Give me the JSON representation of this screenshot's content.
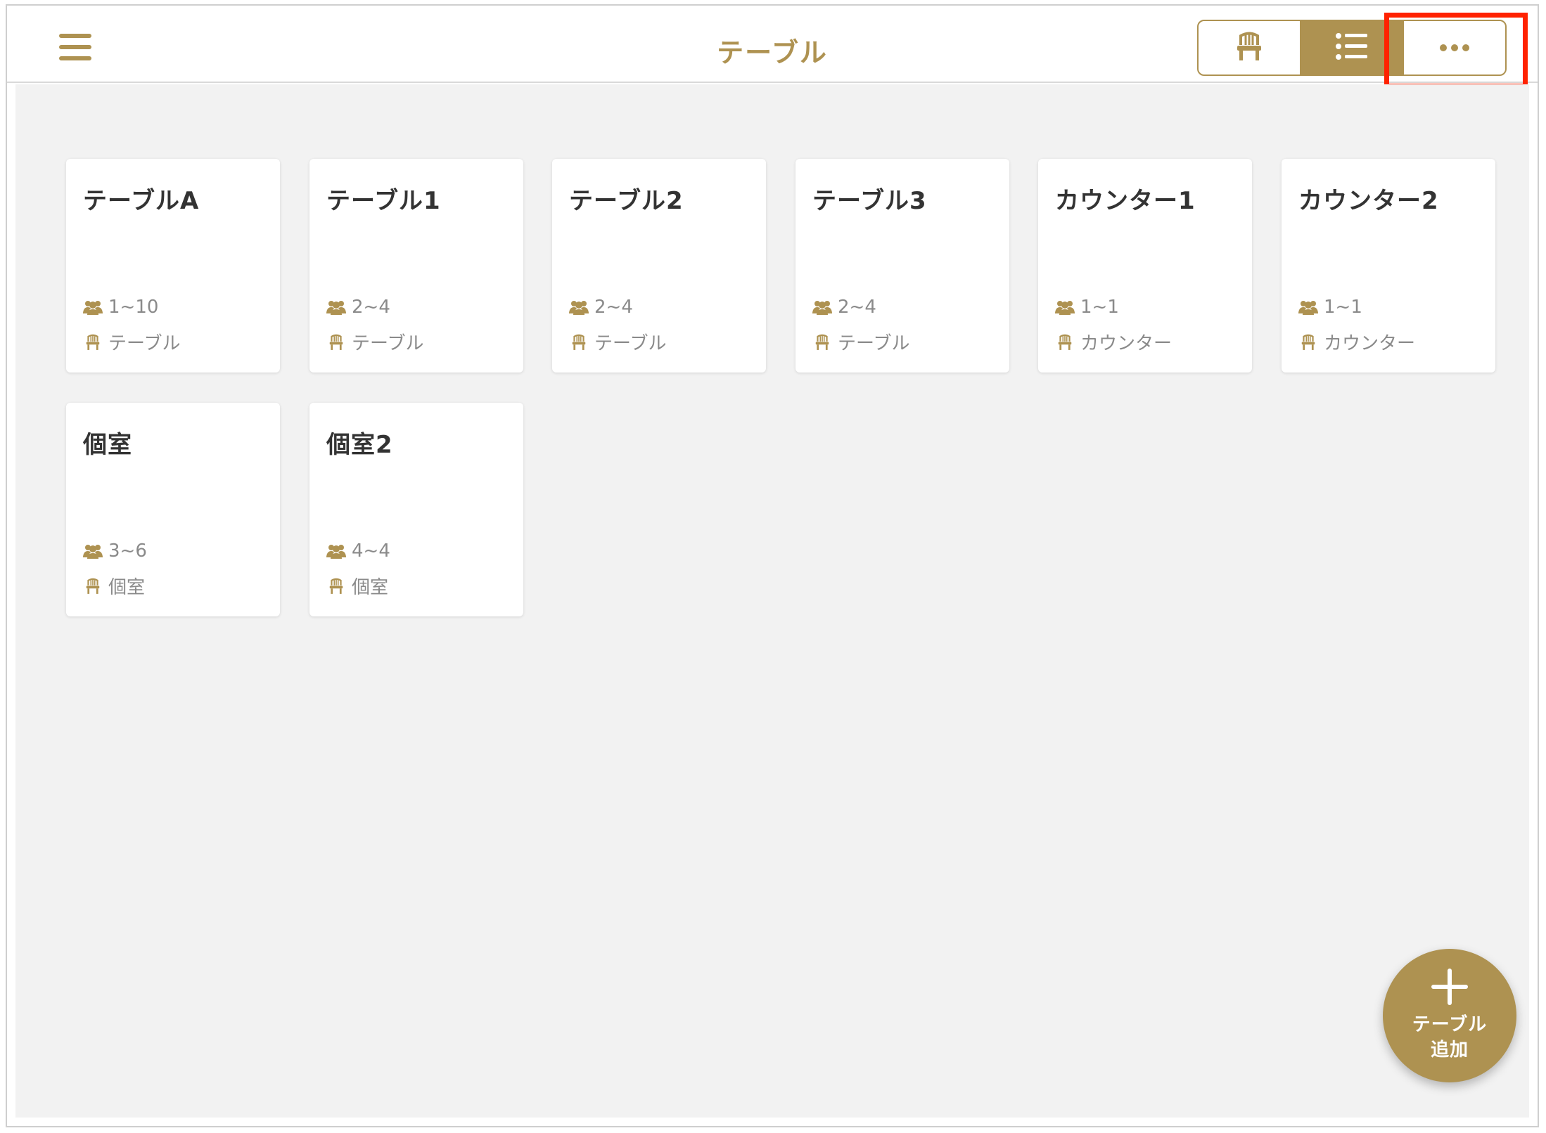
{
  "colors": {
    "accent": "#ae9251",
    "content_bg": "#f2f2f2",
    "highlight": "#ff2200"
  },
  "header": {
    "title": "テーブル",
    "menu_icon": "hamburger-icon",
    "view_switch": {
      "options": [
        {
          "name": "floor",
          "icon": "chair-icon",
          "selected": false
        },
        {
          "name": "list",
          "icon": "list-icon",
          "selected": true
        },
        {
          "name": "more",
          "icon": "more-icon",
          "selected": false
        }
      ]
    }
  },
  "tables": [
    {
      "name": "テーブルA",
      "capacity": "1~10",
      "type": "テーブル"
    },
    {
      "name": "テーブル1",
      "capacity": "2~4",
      "type": "テーブル"
    },
    {
      "name": "テーブル2",
      "capacity": "2~4",
      "type": "テーブル"
    },
    {
      "name": "テーブル3",
      "capacity": "2~4",
      "type": "テーブル"
    },
    {
      "name": "カウンター1",
      "capacity": "1~1",
      "type": "カウンター"
    },
    {
      "name": "カウンター2",
      "capacity": "1~1",
      "type": "カウンター"
    },
    {
      "name": "個室",
      "capacity": "3~6",
      "type": "個室"
    },
    {
      "name": "個室2",
      "capacity": "4~4",
      "type": "個室"
    }
  ],
  "fab": {
    "icon": "plus-icon",
    "line1": "テーブル",
    "line2": "追加"
  }
}
